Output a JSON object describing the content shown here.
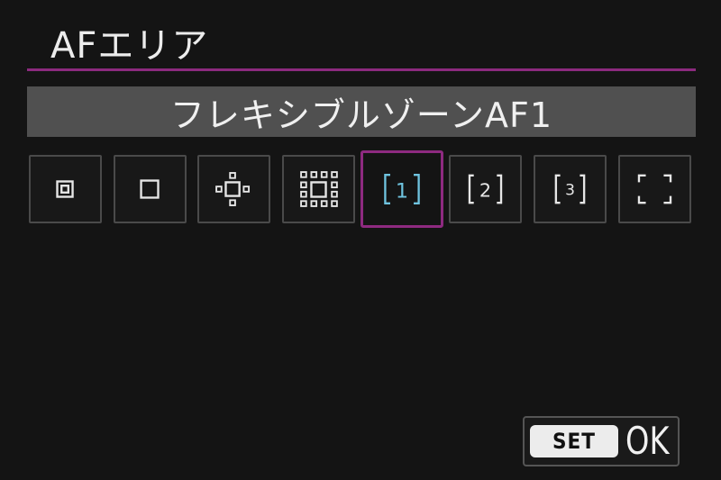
{
  "screen": {
    "title": "AFエリア",
    "mode_name": "フレキシブルゾーンAF1"
  },
  "af_area_options": [
    {
      "icon": "spot-af-icon",
      "selected": false
    },
    {
      "icon": "single-point-af-icon",
      "selected": false
    },
    {
      "icon": "expand-af-cross-icon",
      "selected": false
    },
    {
      "icon": "expand-af-surround-icon",
      "selected": false
    },
    {
      "icon": "flexible-zone-1-icon",
      "label": "1",
      "selected": true
    },
    {
      "icon": "flexible-zone-2-icon",
      "label": "2",
      "selected": false
    },
    {
      "icon": "flexible-zone-3-icon",
      "label": "3",
      "selected": false
    },
    {
      "icon": "whole-area-af-icon",
      "selected": false
    }
  ],
  "footer": {
    "set_label": "SET",
    "ok_label": "OK"
  },
  "colors": {
    "accent": "#8e2a80",
    "selected_icon": "#6fc4e0",
    "background": "#141414",
    "mode_bar": "#505050"
  }
}
